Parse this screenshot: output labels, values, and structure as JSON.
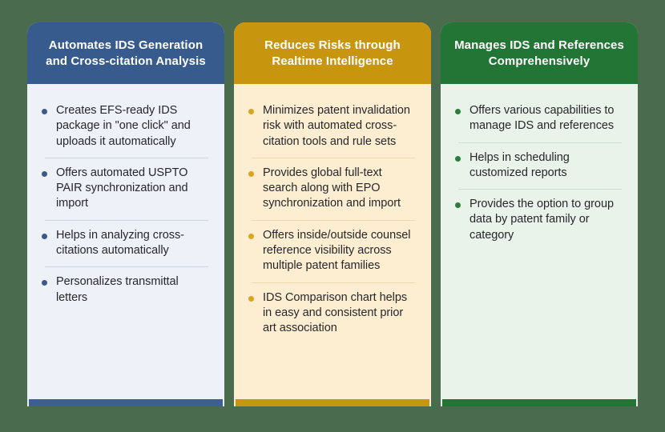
{
  "background_color": "#4a6b4d",
  "cards": [
    {
      "id": "automates-ids-generation",
      "title": "Automates IDS Generation and Cross-citation Analysis",
      "accent_color": "#375b8c",
      "body_color": "#eef1f8",
      "footer_color": "#3d5f96",
      "bullet_color": "#39598d",
      "bullets": [
        "Creates EFS-ready IDS package in \"one click\" and uploads it automatically",
        "Offers automated USPTO PAIR synchronization and import",
        "Helps in analyzing cross-citations automatically",
        "Personalizes transmittal letters"
      ]
    },
    {
      "id": "reduces-risks",
      "title": "Reduces Risks through Realtime Intelligence",
      "accent_color": "#c8950f",
      "body_color": "#fdeed2",
      "footer_color": "#c8950f",
      "bullet_color": "#d9a521",
      "bullets": [
        "Minimizes patent invalidation risk with automated cross-citation tools and rule sets",
        "Provides global full-text search along with EPO synchronization and import",
        "Offers inside/outside counsel reference visibility across multiple patent families",
        "IDS Comparison chart helps in easy and consistent prior art association"
      ]
    },
    {
      "id": "manages-ids-references",
      "title": "Manages IDS and References Comprehensively",
      "accent_color": "#237536",
      "body_color": "#e9f3ea",
      "footer_color": "#237536",
      "bullet_color": "#2a7d3c",
      "bullets": [
        "Offers various capabilities to manage IDS and references",
        "Helps in scheduling customized reports",
        "Provides the option to group data by patent family or category"
      ]
    }
  ]
}
